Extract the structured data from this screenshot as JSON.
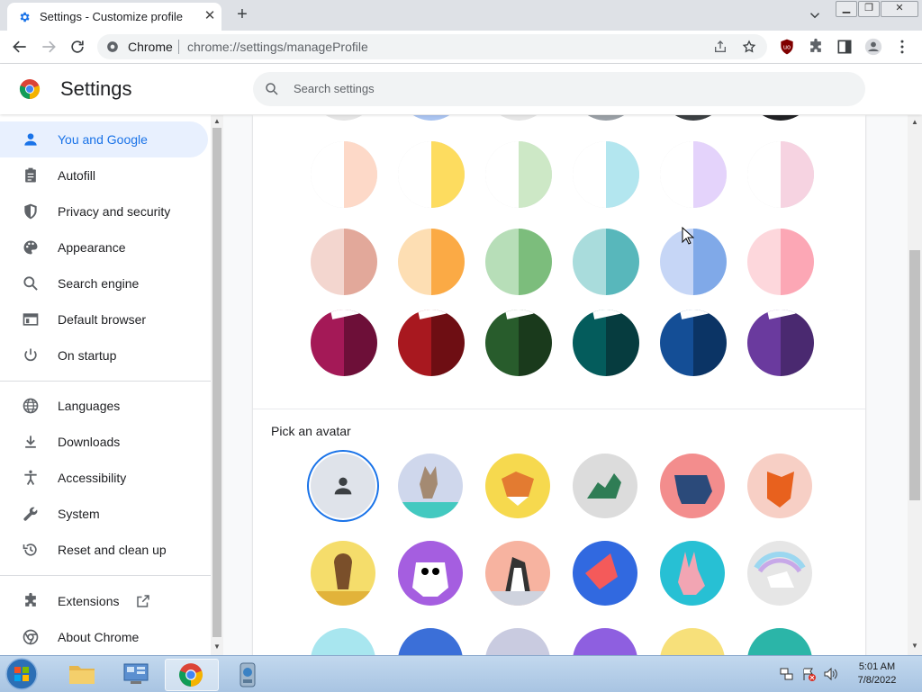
{
  "browser": {
    "tab_title": "Settings - Customize profile",
    "omnibox_site": "Chrome",
    "omnibox_url": "chrome://settings/manageProfile"
  },
  "settings": {
    "title": "Settings",
    "search_placeholder": "Search settings"
  },
  "sidebar": {
    "items": [
      {
        "label": "You and Google",
        "icon": "person-icon"
      },
      {
        "label": "Autofill",
        "icon": "clipboard-icon"
      },
      {
        "label": "Privacy and security",
        "icon": "shield-icon"
      },
      {
        "label": "Appearance",
        "icon": "palette-icon"
      },
      {
        "label": "Search engine",
        "icon": "search-icon"
      },
      {
        "label": "Default browser",
        "icon": "browser-window-icon"
      },
      {
        "label": "On startup",
        "icon": "power-icon"
      },
      {
        "label": "Languages",
        "icon": "globe-icon"
      },
      {
        "label": "Downloads",
        "icon": "download-icon"
      },
      {
        "label": "Accessibility",
        "icon": "accessibility-icon"
      },
      {
        "label": "System",
        "icon": "wrench-icon"
      },
      {
        "label": "Reset and clean up",
        "icon": "history-icon"
      },
      {
        "label": "Extensions",
        "icon": "puzzle-icon"
      },
      {
        "label": "About Chrome",
        "icon": "chrome-logo-icon"
      }
    ]
  },
  "theme_colors": {
    "rows": [
      [
        [
          "#ffffff",
          "#fdd9c8"
        ],
        [
          "#ffffff",
          "#fddc5f"
        ],
        [
          "#ffffff",
          "#cde8c6"
        ],
        [
          "#ffffff",
          "#b3e6ef"
        ],
        [
          "#ffffff",
          "#e4d3fb"
        ],
        [
          "#ffffff",
          "#f6d3e1"
        ]
      ],
      [
        [
          "#f3d6cf",
          "#e2a89a"
        ],
        [
          "#fddeb3",
          "#fbaa45"
        ],
        [
          "#b7deb8",
          "#7cbd7c"
        ],
        [
          "#a9dcdc",
          "#58b7bb"
        ],
        [
          "#c6d6f6",
          "#80a9e8"
        ],
        [
          "#fdd7dc",
          "#fca7b5"
        ]
      ],
      [
        [
          "#a41957",
          "#6d0f38"
        ],
        [
          "#a8181f",
          "#6e0e13"
        ],
        [
          "#285c2c",
          "#1a3a1c"
        ],
        [
          "#045c5c",
          "#063c3f"
        ],
        [
          "#144e96",
          "#0b3465"
        ],
        [
          "#6a3a9e",
          "#4a2970"
        ]
      ]
    ]
  },
  "avatars": {
    "label": "Pick an avatar",
    "items": [
      {
        "name": "generic-avatar",
        "bg": "#dfe3ea"
      },
      {
        "name": "cat-avatar",
        "bg": "#cfd7ec"
      },
      {
        "name": "fox-avatar",
        "bg": "#f6d94e"
      },
      {
        "name": "dragon-avatar",
        "bg": "#dcdcdc"
      },
      {
        "name": "elephant-avatar",
        "bg": "#f38d8d"
      },
      {
        "name": "red-fox-avatar",
        "bg": "#f7cfc5"
      },
      {
        "name": "monkey-avatar",
        "bg": "#f5dd6b"
      },
      {
        "name": "panda-avatar",
        "bg": "#a55ee0"
      },
      {
        "name": "penguin-avatar",
        "bg": "#f7b3a0"
      },
      {
        "name": "bird-avatar",
        "bg": "#3169e0"
      },
      {
        "name": "rabbit-avatar",
        "bg": "#27c0d4"
      },
      {
        "name": "unicorn-avatar",
        "bg": "#e6e6e6"
      }
    ]
  },
  "taskbar": {
    "time": "5:01 AM",
    "date": "7/8/2022"
  }
}
